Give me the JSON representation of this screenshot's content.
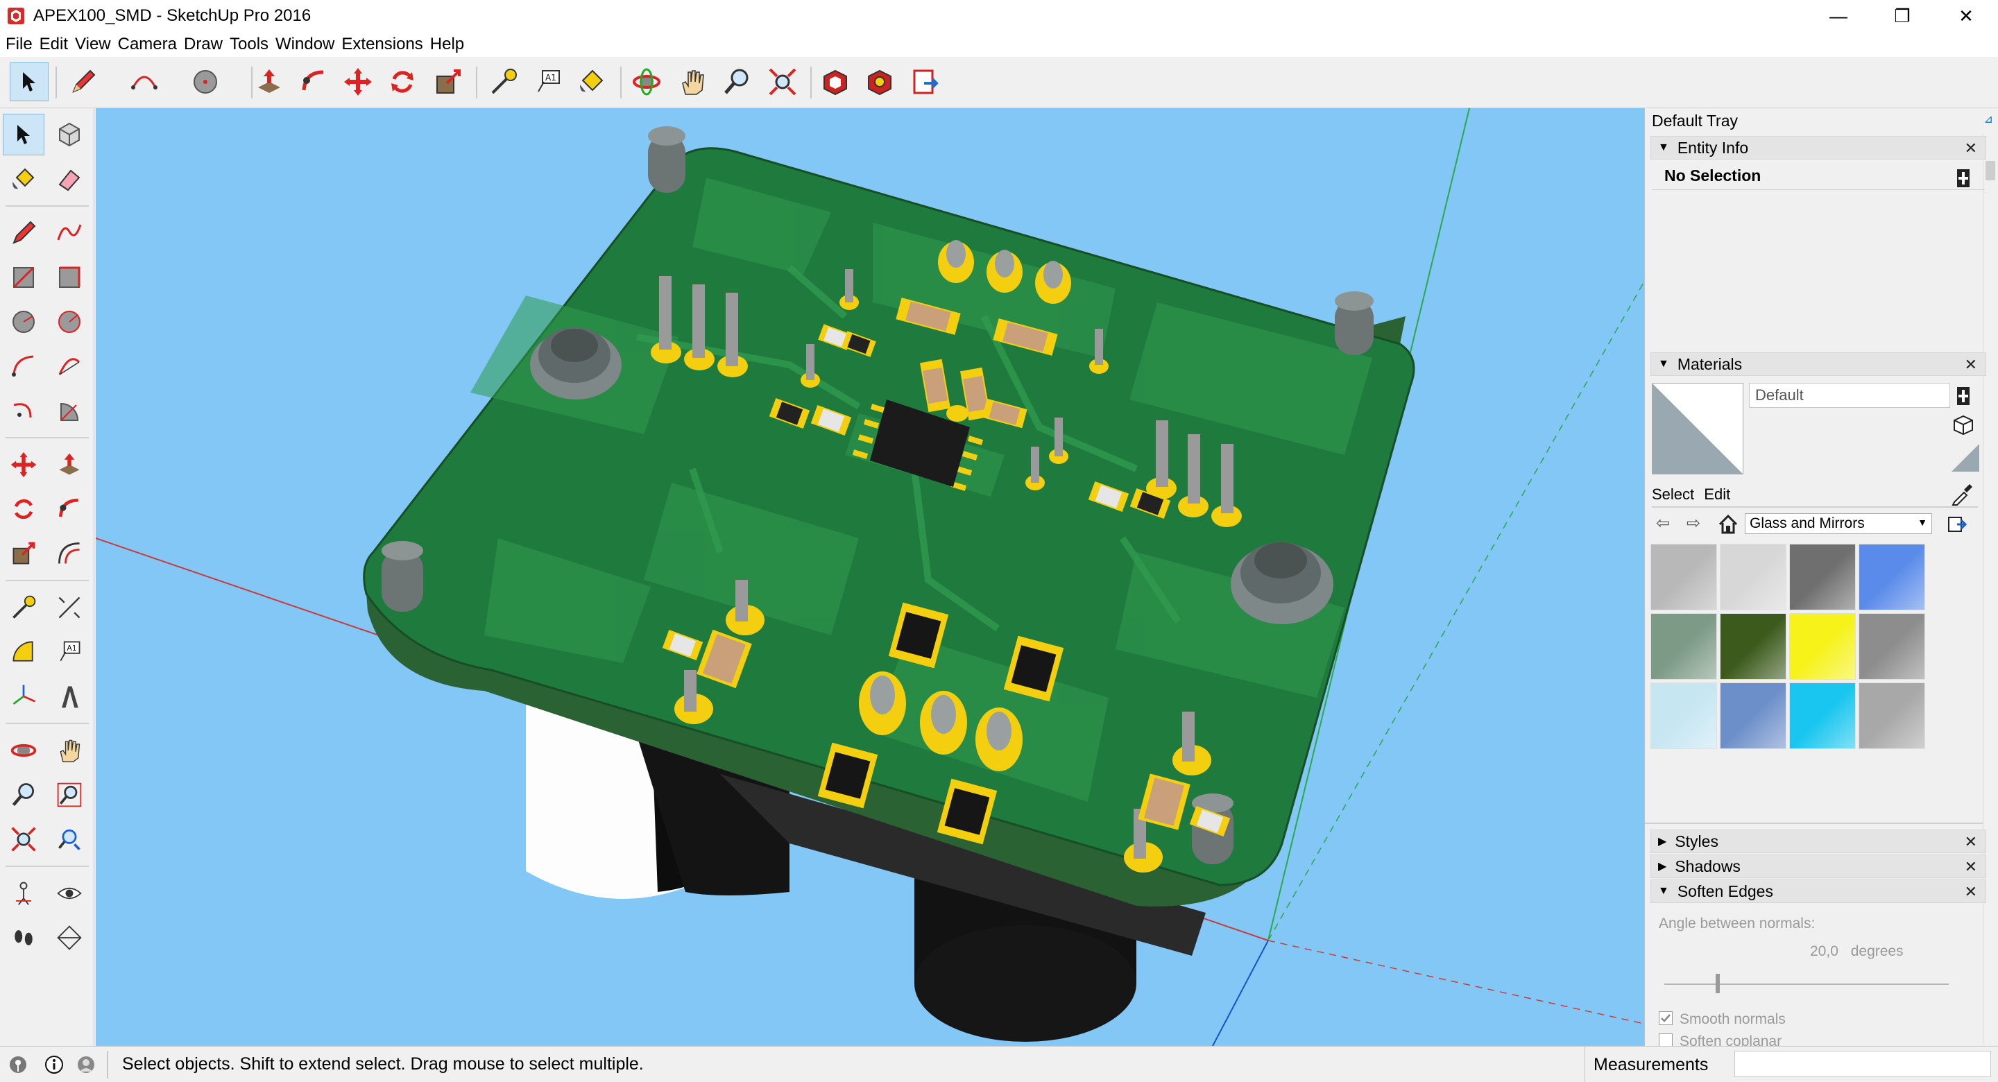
{
  "window": {
    "title": "APEX100_SMD - SketchUp Pro 2016",
    "minimize": "—",
    "restore": "❐",
    "close": "✕"
  },
  "menu": [
    "File",
    "Edit",
    "View",
    "Camera",
    "Draw",
    "Tools",
    "Window",
    "Extensions",
    "Help"
  ],
  "tray": {
    "title": "Default Tray",
    "entity_info": {
      "title": "Entity Info",
      "selection": "No Selection"
    },
    "materials": {
      "title": "Materials",
      "current_material": "Default",
      "tab_select": "Select",
      "tab_edit": "Edit",
      "library": "Glass and Mirrors",
      "swatches": [
        {
          "name": "glass-grey-gradient",
          "color": "#b8b8b8"
        },
        {
          "name": "glass-silver-gradient",
          "color": "#d7d7d7"
        },
        {
          "name": "glass-block",
          "color": "#6f6f6f"
        },
        {
          "name": "glass-blue-translucent",
          "color": "#5a8bea"
        },
        {
          "name": "glass-corrugated-green",
          "color": "#7c9a86"
        },
        {
          "name": "glass-green-translucent",
          "color": "#3c5a1c"
        },
        {
          "name": "glass-yellow-translucent",
          "color": "#f6f21a"
        },
        {
          "name": "glass-grey-translucent",
          "color": "#8d8d8d"
        },
        {
          "name": "glass-diamond-light-blue",
          "color": "#c6e6f2"
        },
        {
          "name": "glass-sky-reflection",
          "color": "#6d8fc9"
        },
        {
          "name": "glass-cyan-translucent",
          "color": "#19c6ef"
        },
        {
          "name": "glass-frosted-noise",
          "color": "#a8a8a8"
        }
      ]
    },
    "styles": {
      "title": "Styles"
    },
    "shadows": {
      "title": "Shadows"
    },
    "soften_edges": {
      "title": "Soften Edges",
      "angle_label": "Angle between normals:",
      "angle_value": "20,0",
      "angle_unit": "degrees",
      "angle_fraction": 0.18,
      "smooth_normals": "Smooth normals",
      "smooth_normals_checked": true,
      "soften_coplanar": "Soften coplanar",
      "soften_coplanar_checked": false
    }
  },
  "status": {
    "hint": "Select objects. Shift to extend select. Drag mouse to select multiple.",
    "measurements_label": "Measurements",
    "measurements_value": ""
  },
  "colors": {
    "viewport_sky": "#82c7f5",
    "pcb_green": "#1f7a3e",
    "pad_gold": "#f3cf10",
    "selection_blue": "#cde6f7"
  }
}
